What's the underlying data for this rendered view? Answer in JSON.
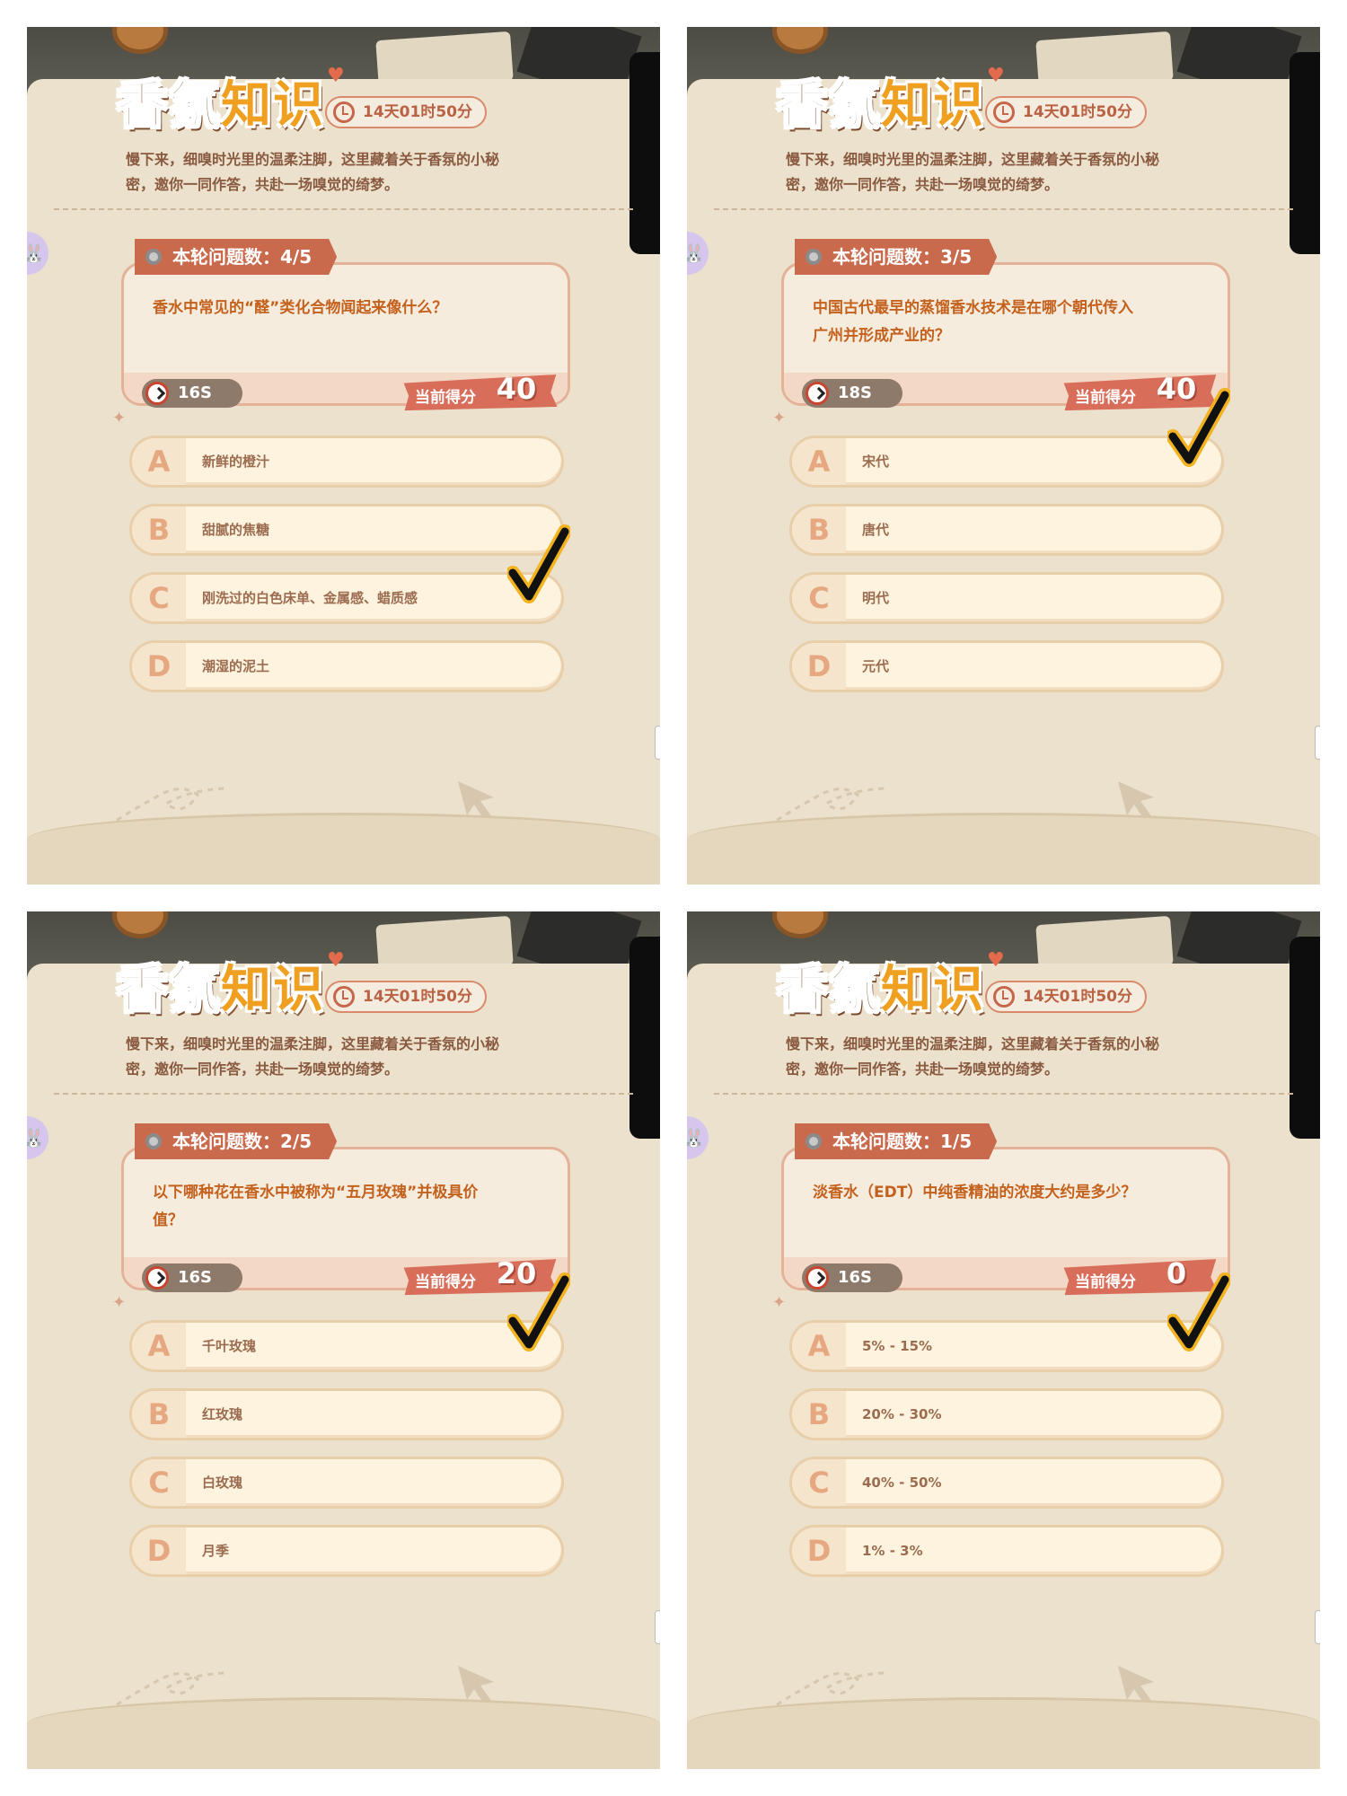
{
  "common": {
    "title_part1": "香氛",
    "title_part2": "知识",
    "countdown": "14天01时50分",
    "intro_line1": "慢下来，细嗅时光里的温柔注脚，这里藏着关于香氛的小秘",
    "intro_line2": "密，邀你一同作答，共赴一场嗅觉的绮梦。",
    "round_label": "本轮问题数：",
    "score_label": "当前得分",
    "letters": [
      "A",
      "B",
      "C",
      "D"
    ],
    "icons": [
      "clock-icon",
      "gear-icon",
      "stopwatch-icon",
      "check-mark-icon",
      "rabbit-icon"
    ],
    "colors": {
      "panel_bg": "#ebe0cc",
      "accent": "#c96a4c",
      "question_text": "#c4611d",
      "check": "#111111",
      "check_outline": "#f2b31f"
    }
  },
  "panels": [
    {
      "round": "4/5",
      "question_line1": "香水中常见的“醛”类化合物闻起来像什么？",
      "question_line2": "",
      "timer": "16S",
      "score": "40",
      "options": [
        "新鲜的橙汁",
        "甜腻的焦糖",
        "刚洗过的白色床单、金属感、蜡质感",
        "潮湿的泥土"
      ],
      "checked_option": "C"
    },
    {
      "round": "3/5",
      "question_line1": "中国古代最早的蒸馏香水技术是在哪个朝代传入",
      "question_line2": "广州并形成产业的？",
      "timer": "18S",
      "score": "40",
      "options": [
        "宋代",
        "唐代",
        "明代",
        "元代"
      ],
      "checked_option": "A"
    },
    {
      "round": "2/5",
      "question_line1": "以下哪种花在香水中被称为“五月玫瑰”并极具价",
      "question_line2": "值？",
      "timer": "16S",
      "score": "20",
      "options": [
        "千叶玫瑰",
        "红玫瑰",
        "白玫瑰",
        "月季"
      ],
      "checked_option": "A"
    },
    {
      "round": "1/5",
      "question_line1": "淡香水（EDT）中纯香精油的浓度大约是多少？",
      "question_line2": "",
      "timer": "16S",
      "score": "0",
      "options": [
        "5% - 15%",
        "20% - 30%",
        "40% - 50%",
        "1% - 3%"
      ],
      "checked_option": "A"
    }
  ]
}
